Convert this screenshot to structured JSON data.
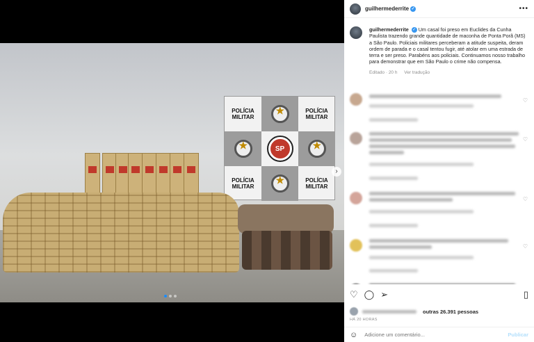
{
  "post": {
    "username": "guilhermederrite",
    "caption_text": "Um casal foi preso em Euclides da Cunha Paulista trazendo grande quantidade de maconha de Ponta Porã (MS) a São Paulo. Policiais militares perceberam a atitude suspeita, deram ordem de parada e o casal tentou fugir, até atolar em uma estrada de terra e ser preso. Parabéns aos policiais. Continuamos nosso trabalho para demonstrar que em São Paulo o crime não compensa.",
    "edited_label": "Editado · 20 h",
    "see_translation": "Ver tradução"
  },
  "photo": {
    "board_labels": [
      "POLÍCIA MILITAR",
      "POLÍCIA MILITAR",
      "POLÍCIA MILITAR",
      "POLÍCIA MILITAR"
    ],
    "seal_text": "SP",
    "next_glyph": "›"
  },
  "likes": {
    "others_text": "outras 26.391 pessoas",
    "prefix": "Curtido por"
  },
  "timestamp": "HÁ 20 HORAS",
  "composer": {
    "placeholder": "Adicione um comentário...",
    "publish": "Publicar"
  },
  "icons": {
    "more": "more-options-icon",
    "like": "heart-icon",
    "comment": "comment-icon",
    "share": "share-icon",
    "save": "bookmark-icon",
    "emoji": "emoji-icon"
  },
  "colors": {
    "verified": "#3897f0",
    "publish": "#b2dffc",
    "carousel_active": "#1a8cff"
  }
}
